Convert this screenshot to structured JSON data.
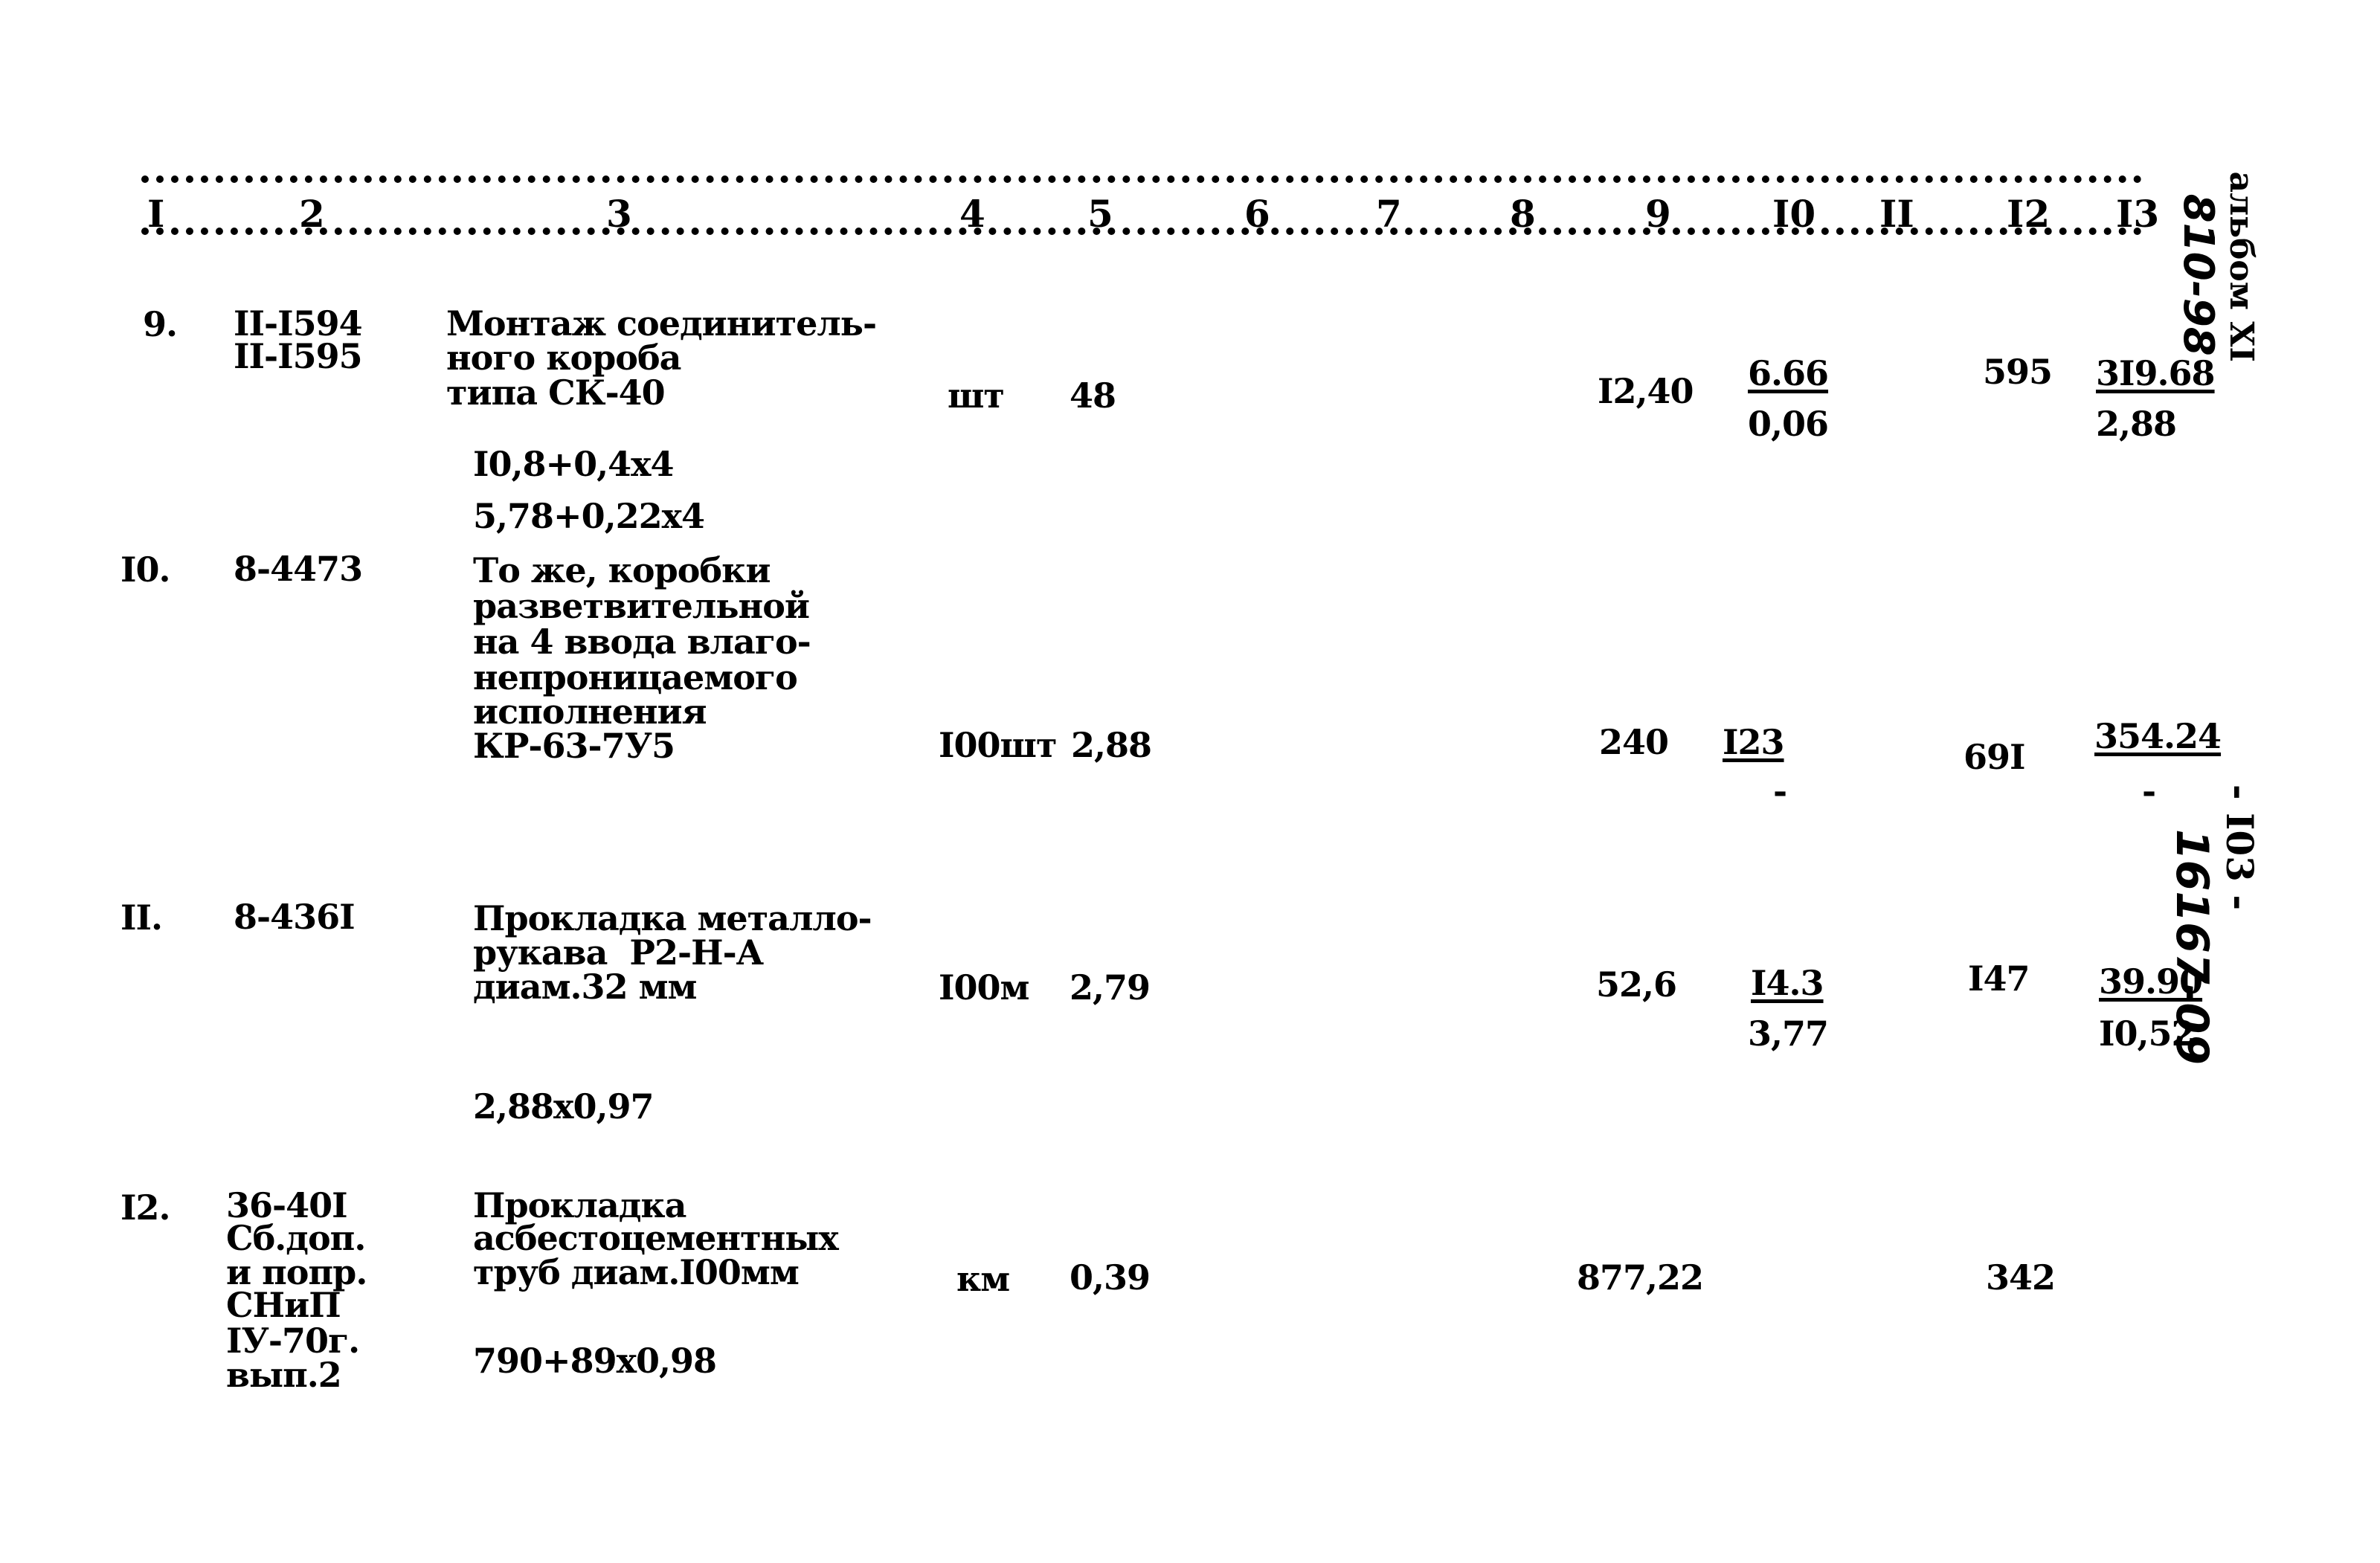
{
  "header": {
    "columns": [
      "I",
      "2",
      "3",
      "4",
      "5",
      "6",
      "7",
      "8",
      "9",
      "I0",
      "II",
      "I2",
      "I3"
    ]
  },
  "margin": {
    "album": "альбом XI",
    "album_code": "810-98",
    "page": "- I03 -",
    "doc_code": "16167-09"
  },
  "rows": [
    {
      "num": "9.",
      "code": [
        "II-I594",
        "II-I595"
      ],
      "desc": [
        "Монтаж соединитель-",
        "ного короба",
        "типа СК-40"
      ],
      "calc": [
        "I0,8+0,4x4",
        "5,78+0,22x4"
      ],
      "unit": "шт",
      "qty": "48",
      "c9": "I2,40",
      "c10_top": "6.66",
      "c10_bot": "0,06",
      "c12": "595",
      "c13_top": "3I9.68",
      "c13_bot": "2,88"
    },
    {
      "num": "I0.",
      "code": [
        "8-4473"
      ],
      "desc": [
        "То же, коробки",
        "разветвительной",
        "на 4 ввода влаго-",
        "непроницаемого",
        "исполнения",
        "КР-63-7У5"
      ],
      "calc": [],
      "unit": "I00шт",
      "qty": "2,88",
      "c9": "240",
      "c10_top": "I23",
      "c10_bot": "-",
      "c12": "69I",
      "c13_top": "354.24",
      "c13_bot": "-"
    },
    {
      "num": "II.",
      "code": [
        "8-436I"
      ],
      "desc": [
        "Прокладка металло-",
        "рукава  Р2-Н-А",
        "диам.32 мм"
      ],
      "calc": [
        "2,88x0,97"
      ],
      "unit": "I00м",
      "qty": "2,79",
      "c9": "52,6",
      "c10_top": "I4.3",
      "c10_bot": "3,77",
      "c12": "I47",
      "c13_top": "39.90",
      "c13_bot": "I0,52"
    },
    {
      "num": "I2.",
      "code": [
        "36-40I",
        "Сб.доп.",
        "и попр.",
        "СНиП",
        "IУ-70г.",
        "вып.2"
      ],
      "desc": [
        "Прокладка",
        "асбестоцементных",
        "труб диам.I00мм"
      ],
      "calc": [
        "790+89x0,98"
      ],
      "unit": "км",
      "qty": "0,39",
      "c9": "877,22",
      "c10_top": "",
      "c10_bot": "",
      "c12": "342",
      "c13_top": "",
      "c13_bot": ""
    }
  ]
}
